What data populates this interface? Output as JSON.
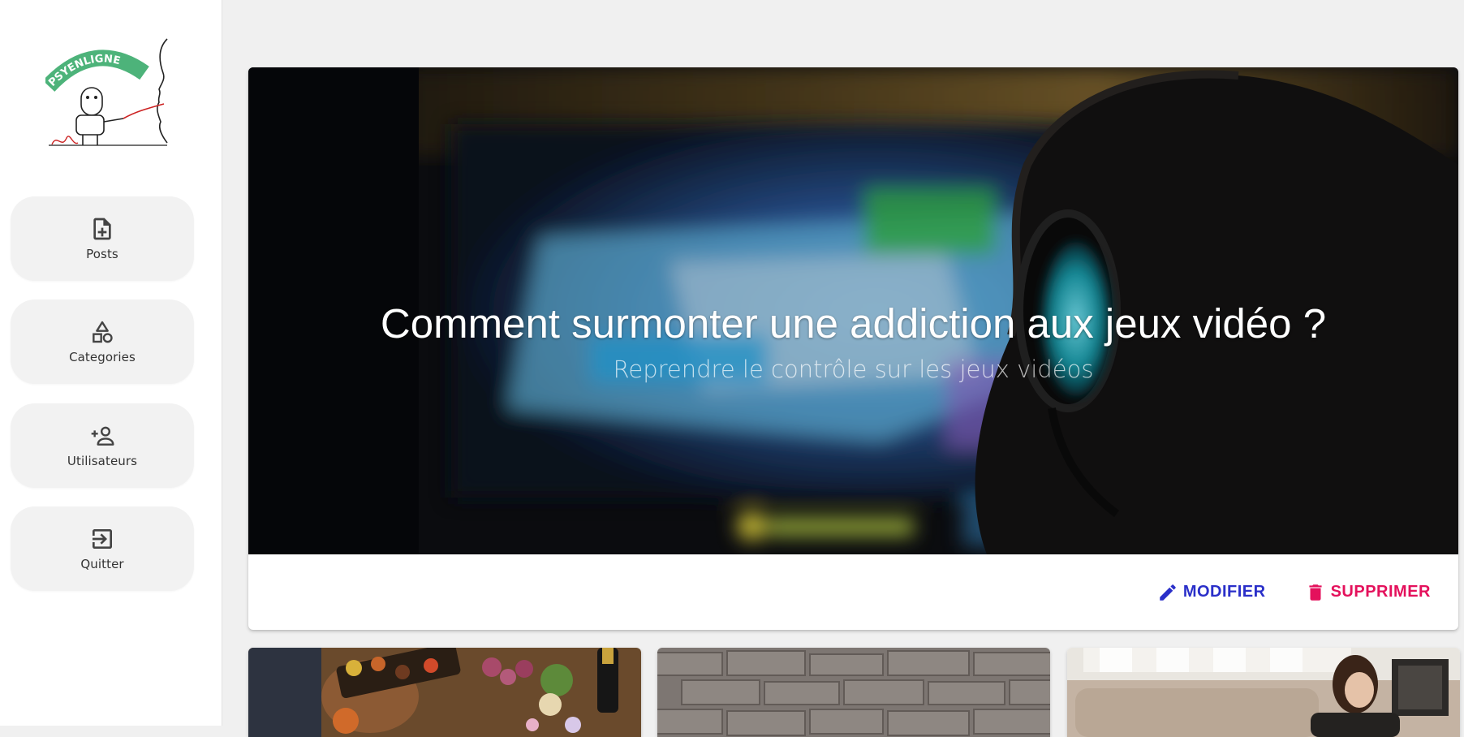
{
  "sidebar": {
    "logo_text": "PSYENLIGNE",
    "items": [
      {
        "label": "Posts",
        "icon": "file-plus-icon"
      },
      {
        "label": "Categories",
        "icon": "shapes-icon"
      },
      {
        "label": "Utilisateurs",
        "icon": "person-add-icon"
      },
      {
        "label": "Quitter",
        "icon": "exit-icon"
      }
    ]
  },
  "hero": {
    "title": "Comment surmonter une addiction aux jeux vidéo ?",
    "subtitle": "Reprendre le contrôle sur les jeux vidéos",
    "actions": {
      "edit_label": "MODIFIER",
      "delete_label": "SUPPRIMER"
    }
  },
  "colors": {
    "edit": "#2a2fc9",
    "delete": "#e4115c",
    "logo_green": "#4db37a"
  }
}
